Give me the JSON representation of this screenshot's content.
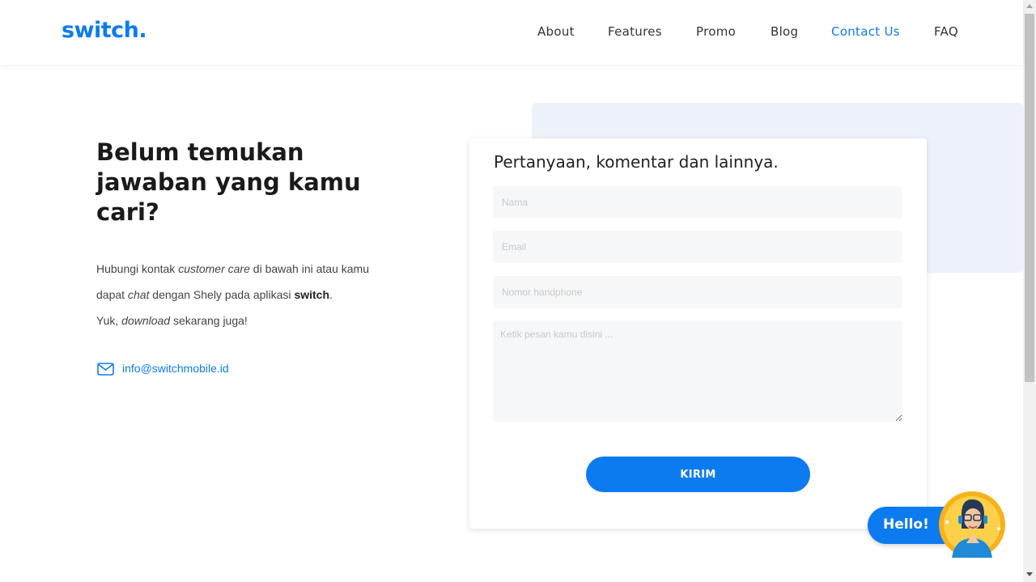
{
  "header": {
    "logo": "switch.",
    "nav": [
      {
        "label": "About"
      },
      {
        "label": "Features"
      },
      {
        "label": "Promo"
      },
      {
        "label": "Blog"
      },
      {
        "label": "Contact Us",
        "active": true
      },
      {
        "label": "FAQ"
      }
    ]
  },
  "intro": {
    "headline": "Belum temukan jawaban yang kamu cari?",
    "line1_a": "Hubungi kontak ",
    "line1_em": "customer care",
    "line1_b": " di bawah ini atau kamu",
    "line2_a": "dapat ",
    "line2_em": "chat",
    "line2_b": " dengan Shely pada aplikasi ",
    "line2_strong": "switch",
    "line2_c": ".",
    "line3_a": "Yuk, ",
    "line3_em": "download",
    "line3_b": " sekarang juga!",
    "email": "info@switchmobile.id",
    "email_icon": "mail-icon"
  },
  "form": {
    "title": "Pertanyaan, komentar dan lainnya.",
    "name_placeholder": "Nama",
    "email_placeholder": "Email",
    "phone_placeholder": "Nomor handphone",
    "message_placeholder": "Ketik pesan kamu disini ...",
    "submit_label": "KIRIM"
  },
  "chat_widget": {
    "label": "Hello!",
    "avatar_icon": "shely-avatar"
  },
  "colors": {
    "accent": "#0d7bf0",
    "form_background_accent": "#edf2fa",
    "field_background": "#f6f7f8"
  }
}
